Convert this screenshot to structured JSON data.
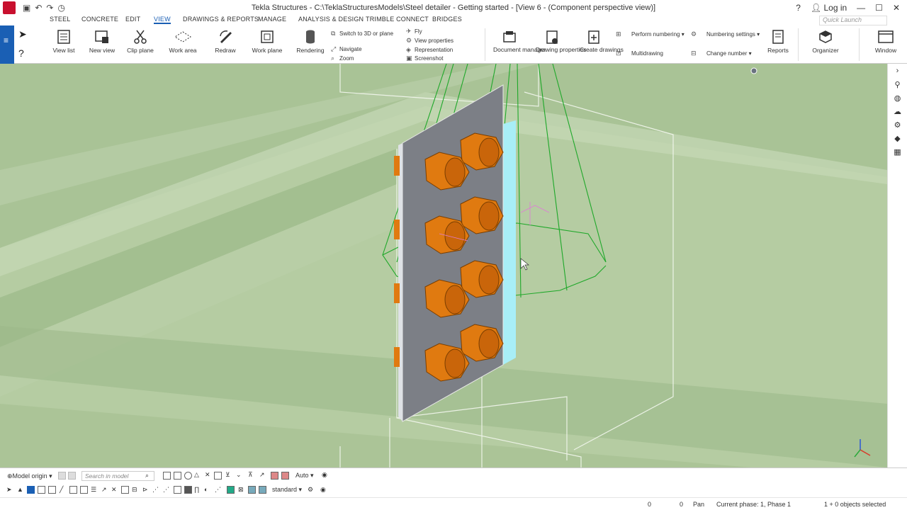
{
  "title": {
    "text": "Tekla Structures - C:\\TeklaStructuresModels\\Steel detailer - Getting started  - [View 6 - (Component perspective view)]",
    "login": "Log in"
  },
  "quick_launch": {
    "placeholder": "Quick Launch"
  },
  "menu": [
    {
      "label": "STEEL",
      "active": false
    },
    {
      "label": "CONCRETE",
      "active": false
    },
    {
      "label": "EDIT",
      "active": false
    },
    {
      "label": "VIEW",
      "active": true
    },
    {
      "label": "DRAWINGS & REPORTS",
      "active": false
    },
    {
      "label": "MANAGE",
      "active": false
    },
    {
      "label": "ANALYSIS & DESIGN",
      "active": false
    },
    {
      "label": "TRIMBLE CONNECT",
      "active": false
    },
    {
      "label": "BRIDGES",
      "active": false
    }
  ],
  "ribbon": {
    "view_list": "View list",
    "new_view": "New view",
    "clip_plane": "Clip plane",
    "work_area": "Work area",
    "redraw": "Redraw",
    "work_plane": "Work plane",
    "rendering": "Rendering",
    "switch_3d": "Switch to 3D or plane",
    "navigate": "Navigate",
    "zoom": "Zoom",
    "fly": "Fly",
    "view_properties": "View properties",
    "representation": "Representation",
    "screenshot": "Screenshot",
    "document_manager": "Document manager",
    "drawing_properties": "Drawing properties",
    "create_drawings": "Create drawings",
    "perform_numbering": "Perform numbering",
    "multidrawing": "Multidrawing",
    "numbering_settings": "Numbering settings",
    "change_number": "Change number",
    "reports": "Reports",
    "organizer": "Organizer",
    "window": "Window"
  },
  "bottom_toolbar": {
    "model_origin": "Model origin",
    "search_placeholder": "Search in model",
    "auto": "Auto",
    "standard": "standard"
  },
  "status": {
    "coord_a": "0",
    "coord_b": "0",
    "mode": "Pan",
    "phase": "Current phase: 1, Phase 1",
    "selection": "1 + 0 objects selected"
  },
  "colors": {
    "viewport_bg": "#b5cca2",
    "accent": "#1a5fb4",
    "bolt": "#e07a10",
    "plate": "#7c7f86",
    "wire": "#1fa82a"
  }
}
